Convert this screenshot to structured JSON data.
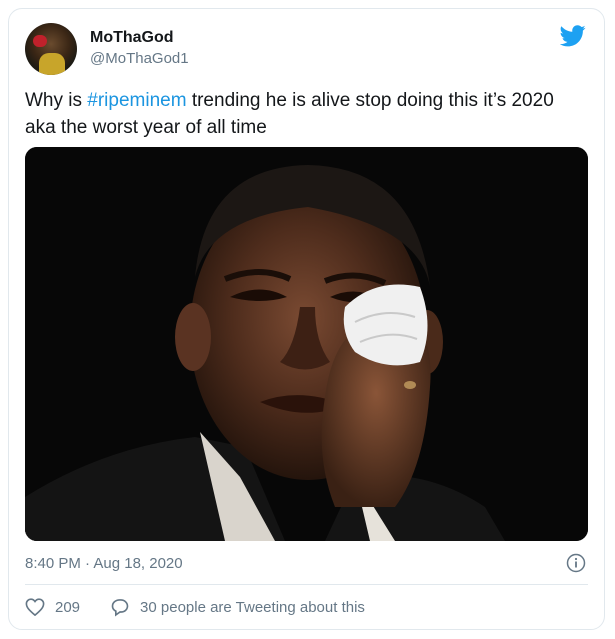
{
  "user": {
    "display_name": "MoThaGod",
    "handle": "@MoThaGod1"
  },
  "tweet": {
    "text_before": "Why is ",
    "hashtag": "#ripeminem",
    "text_after": " trending he is alive stop doing this it’s 2020 aka the worst year of all time"
  },
  "media": {
    "icon": "photo"
  },
  "meta": {
    "timestamp": "8:40 PM · Aug 18, 2020"
  },
  "actions": {
    "likes": "209",
    "reply_text": "30 people are Tweeting about this"
  },
  "colors": {
    "accent": "#1b95e0",
    "twitter_blue": "#1da1f2",
    "muted": "#657786"
  }
}
